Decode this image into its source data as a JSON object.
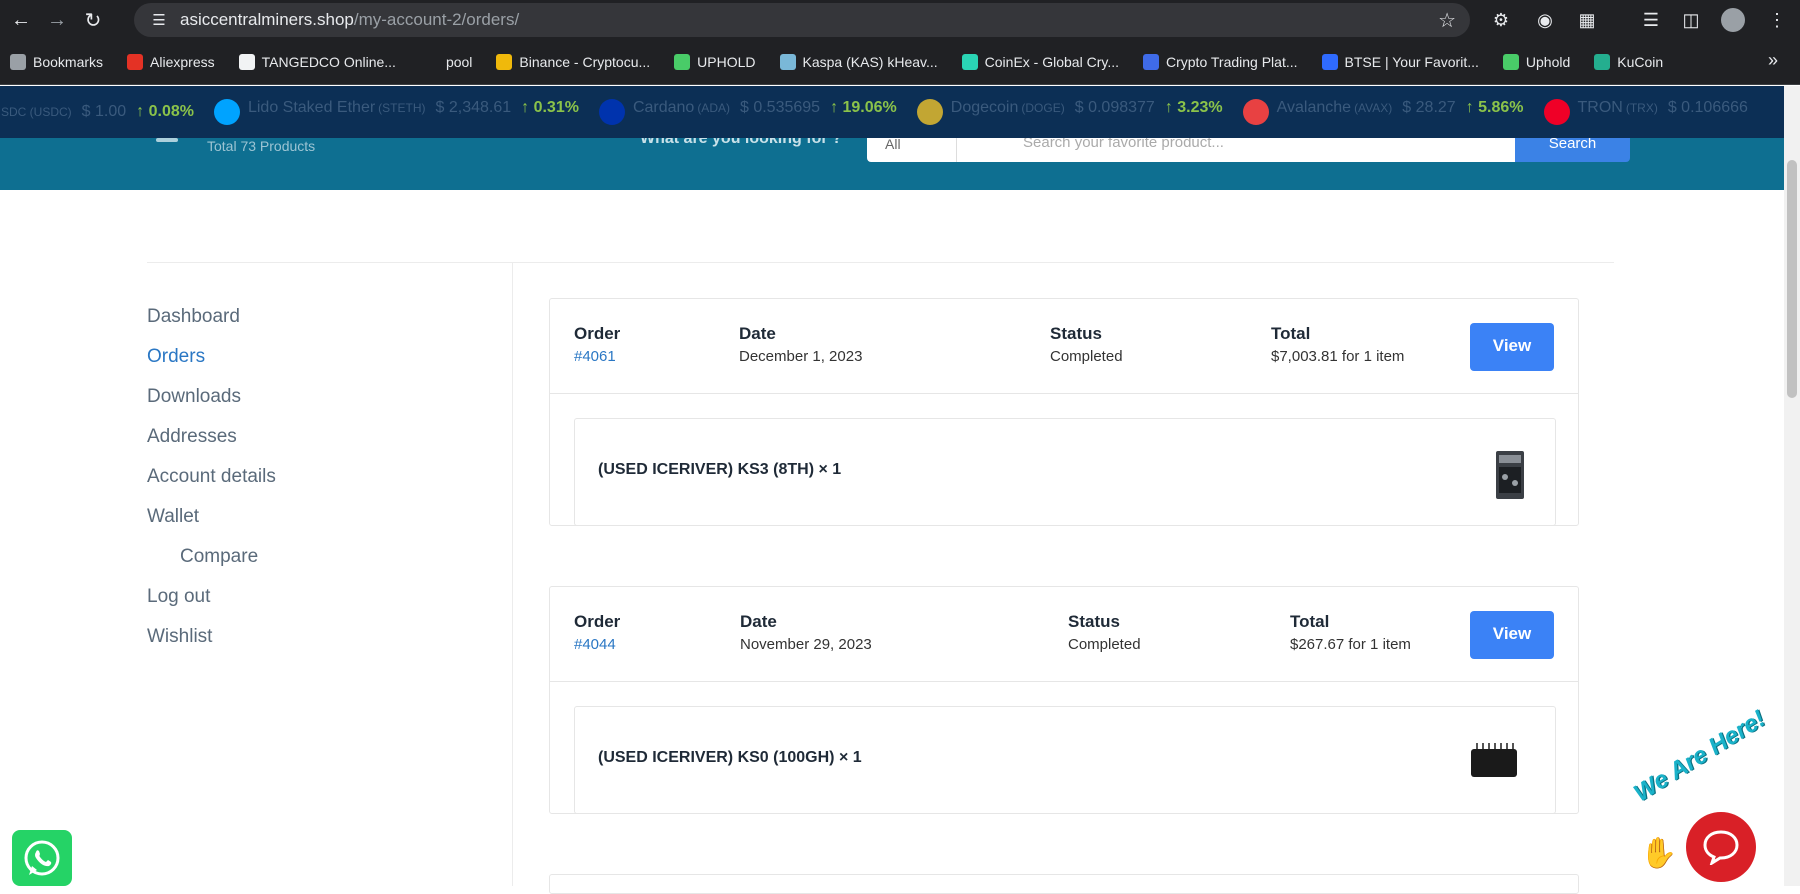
{
  "browser": {
    "url_host": "asiccentralminers.shop",
    "url_path": "/my-account-2/orders/"
  },
  "bookmarks": [
    {
      "label": "Bookmarks",
      "icon": "star-icon",
      "color": "#9aa0a6"
    },
    {
      "label": "Aliexpress",
      "icon": "aliexpress-icon",
      "color": "#e43225"
    },
    {
      "label": "TANGEDCO Online...",
      "icon": "tangedco-icon",
      "color": "#f1f3f4"
    },
    {
      "label": "pool",
      "icon": "",
      "color": ""
    },
    {
      "label": "Binance - Cryptocu...",
      "icon": "binance-icon",
      "color": "#f0b90b"
    },
    {
      "label": "UPHOLD",
      "icon": "uphold-icon",
      "color": "#49cc68"
    },
    {
      "label": "Kaspa (KAS) kHeav...",
      "icon": "kaspa-icon",
      "color": "#7ab8d8"
    },
    {
      "label": "CoinEx - Global Cry...",
      "icon": "coinex-icon",
      "color": "#2ad4b4"
    },
    {
      "label": "Crypto Trading Plat...",
      "icon": "crypto-trading-icon",
      "color": "#3f6be8"
    },
    {
      "label": "BTSE | Your Favorit...",
      "icon": "btse-icon",
      "color": "#2f6bff"
    },
    {
      "label": "Uphold",
      "icon": "uphold-icon",
      "color": "#49cc68"
    },
    {
      "label": "KuCoin",
      "icon": "kucoin-icon",
      "color": "#24ae8f"
    }
  ],
  "ticker": [
    {
      "name": "",
      "symbol": "SDC (USDC)",
      "price": "$ 1.00",
      "change": "↑ 0.08%",
      "color": "#2775ca"
    },
    {
      "name": "Lido Staked Ether",
      "symbol": "(STETH)",
      "price": "$ 2,348.61",
      "change": "↑ 0.31%",
      "color": "#00a3ff"
    },
    {
      "name": "Cardano",
      "symbol": "(ADA)",
      "price": "$ 0.535695",
      "change": "↑ 19.06%",
      "color": "#0033ad"
    },
    {
      "name": "Dogecoin",
      "symbol": "(DOGE)",
      "price": "$ 0.098377",
      "change": "↑ 3.23%",
      "color": "#c2a633"
    },
    {
      "name": "Avalanche",
      "symbol": "(AVAX)",
      "price": "$ 28.27",
      "change": "↑ 5.86%",
      "color": "#e84142"
    },
    {
      "name": "TRON",
      "symbol": "(TRX)",
      "price": "$ 0.106666",
      "change": "",
      "color": "#ef0027"
    }
  ],
  "header": {
    "total_products": "Total 73 Products",
    "looking_for": "What are you looking for ?",
    "category": "All",
    "search_placeholder": "Search your favorite product...",
    "search_button": "Search"
  },
  "sidenav": [
    {
      "label": "Dashboard",
      "active": false
    },
    {
      "label": "Orders",
      "active": true
    },
    {
      "label": "Downloads",
      "active": false
    },
    {
      "label": "Addresses",
      "active": false
    },
    {
      "label": "Account details",
      "active": false
    },
    {
      "label": "Wallet",
      "active": false
    },
    {
      "label": "Compare",
      "active": false,
      "sub": true
    },
    {
      "label": "Log out",
      "active": false
    },
    {
      "label": "Wishlist",
      "active": false
    }
  ],
  "order_labels": {
    "order": "Order",
    "date": "Date",
    "status": "Status",
    "total": "Total",
    "view": "View"
  },
  "orders": [
    {
      "number": "#4061",
      "date": "December 1, 2023",
      "status": "Completed",
      "total": "$7,003.81 for 1 item",
      "item": "(USED ICERIVER) KS3 (8TH) × 1"
    },
    {
      "number": "#4044",
      "date": "November 29, 2023",
      "status": "Completed",
      "total": "$267.67 for 1 item",
      "item": "(USED ICERIVER) KS0 (100GH) × 1"
    }
  ],
  "widgets": {
    "chat_tagline": "We Are Here!"
  },
  "colors": {
    "accent": "#2a77c4",
    "button": "#3b82f6",
    "header_bg": "#0e6f91",
    "ticker_bg": "#0c2f55",
    "positive": "#8bc34a"
  }
}
